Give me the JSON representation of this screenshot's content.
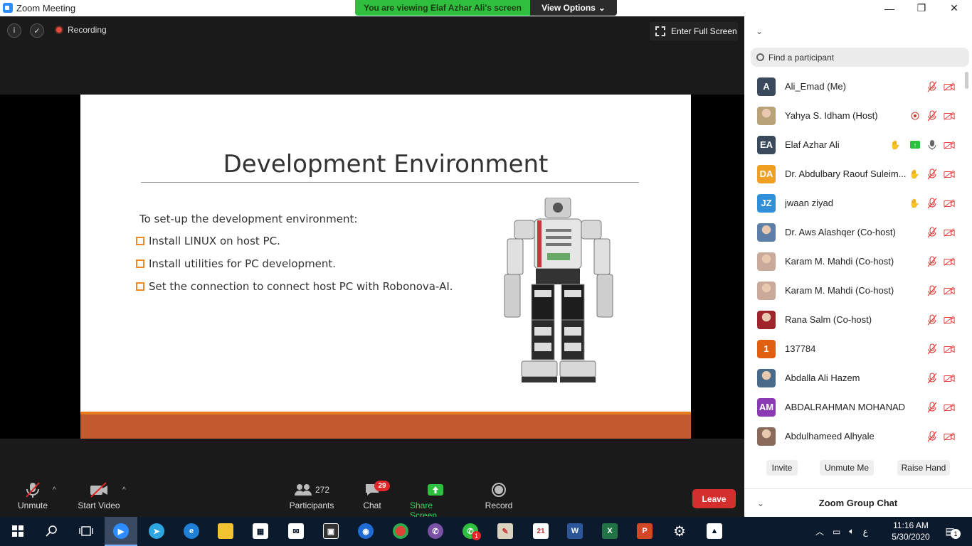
{
  "window": {
    "title": "Zoom Meeting",
    "minimize": "—",
    "maximize": "❐",
    "close": "✕"
  },
  "banner": {
    "viewing": "You are viewing Elaf Azhar Ali's screen",
    "view_options": "View Options",
    "view_options_caret": "⌄"
  },
  "meeting_top": {
    "info_icon": "i",
    "shield_icon": "✓",
    "recording": "Recording",
    "fullscreen": "Enter Full Screen"
  },
  "slide": {
    "title": "Development Environment",
    "intro": "To set-up the development environment:",
    "bullets": [
      "Install LINUX on host PC.",
      "Install utilities for PC development.",
      "Set the connection to connect host PC with Robonova-AI."
    ]
  },
  "toolbar": {
    "unmute": "Unmute",
    "start_video": "Start Video",
    "participants": "Participants",
    "participants_count": "272",
    "chat": "Chat",
    "chat_badge": "29",
    "share_screen": "Share Screen",
    "record": "Record",
    "leave": "Leave",
    "caret": "^"
  },
  "panel": {
    "collapse": "⌄",
    "search_placeholder": "Find a participant",
    "participants": [
      {
        "name": "Ali_Emad (Me)",
        "initials": "A",
        "color": "#3a4a5c",
        "photo": false
      },
      {
        "name": "Yahya S. Idham (Host)",
        "initials": "",
        "color": "#b9a27a",
        "photo": true
      },
      {
        "name": "Elaf Azhar Ali",
        "initials": "EA",
        "color": "#3a4a5c",
        "photo": false
      },
      {
        "name": "Dr. Abdulbary Raouf Suleim...",
        "initials": "DA",
        "color": "#f0a020",
        "photo": false
      },
      {
        "name": "jwaan ziyad",
        "initials": "JZ",
        "color": "#2f8fd8",
        "photo": false
      },
      {
        "name": "Dr. Aws Alashqer (Co-host)",
        "initials": "",
        "color": "#5d7ea6",
        "photo": true
      },
      {
        "name": "Karam M. Mahdi (Co-host)",
        "initials": "",
        "color": "#c9a999",
        "photo": true
      },
      {
        "name": "Karam M. Mahdi (Co-host)",
        "initials": "",
        "color": "#c9a999",
        "photo": true
      },
      {
        "name": "Rana Salm (Co-host)",
        "initials": "",
        "color": "#a0222a",
        "photo": true
      },
      {
        "name": "137784",
        "initials": "1",
        "color": "#e06010",
        "photo": false
      },
      {
        "name": "Abdalla Ali Hazem",
        "initials": "",
        "color": "#4a6a8a",
        "photo": true
      },
      {
        "name": "ABDALRAHMAN MOHANAD",
        "initials": "AM",
        "color": "#8a3bb4",
        "photo": false
      },
      {
        "name": "Abdulhameed Alhyale",
        "initials": "",
        "color": "#8a6a5a",
        "photo": true
      }
    ],
    "invite": "Invite",
    "unmute_me": "Unmute Me",
    "raise_hand": "Raise Hand",
    "group_chat": "Zoom Group Chat",
    "group_chat_caret": "⌄"
  },
  "taskbar": {
    "time": "11:16 AM",
    "date": "5/30/2020",
    "lang": "ع",
    "whatsapp_badge": "1",
    "notif_badge": "1"
  }
}
